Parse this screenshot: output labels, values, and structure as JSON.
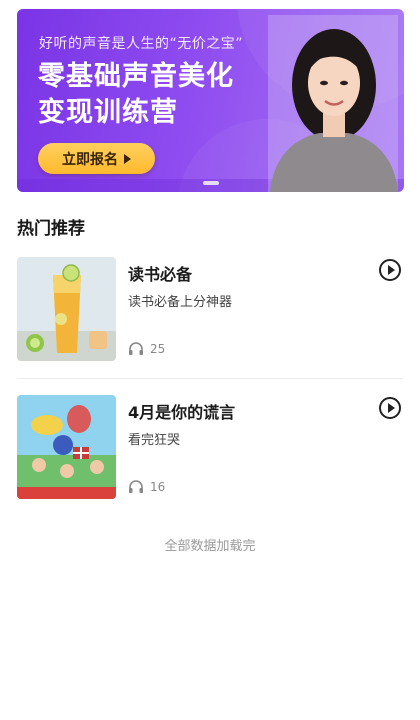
{
  "banner": {
    "kicker": "好听的声音是人生的“无价之宝”",
    "title_line1": "零基础声音美化",
    "title_line2": "变现训练营",
    "cta_label": "立即报名",
    "accent_color": "#8a45ee",
    "cta_color": "#ffc444"
  },
  "section": {
    "title": "热门推荐"
  },
  "items": [
    {
      "title": "读书必备",
      "desc": "读书必备上分神器",
      "plays": "25",
      "thumb": "lemon-tea-image"
    },
    {
      "title": "4月是你的谎言",
      "desc": "看完狂哭",
      "plays": "16",
      "thumb": "cartoon-image"
    }
  ],
  "footer": {
    "note": "全部数据加载完"
  }
}
